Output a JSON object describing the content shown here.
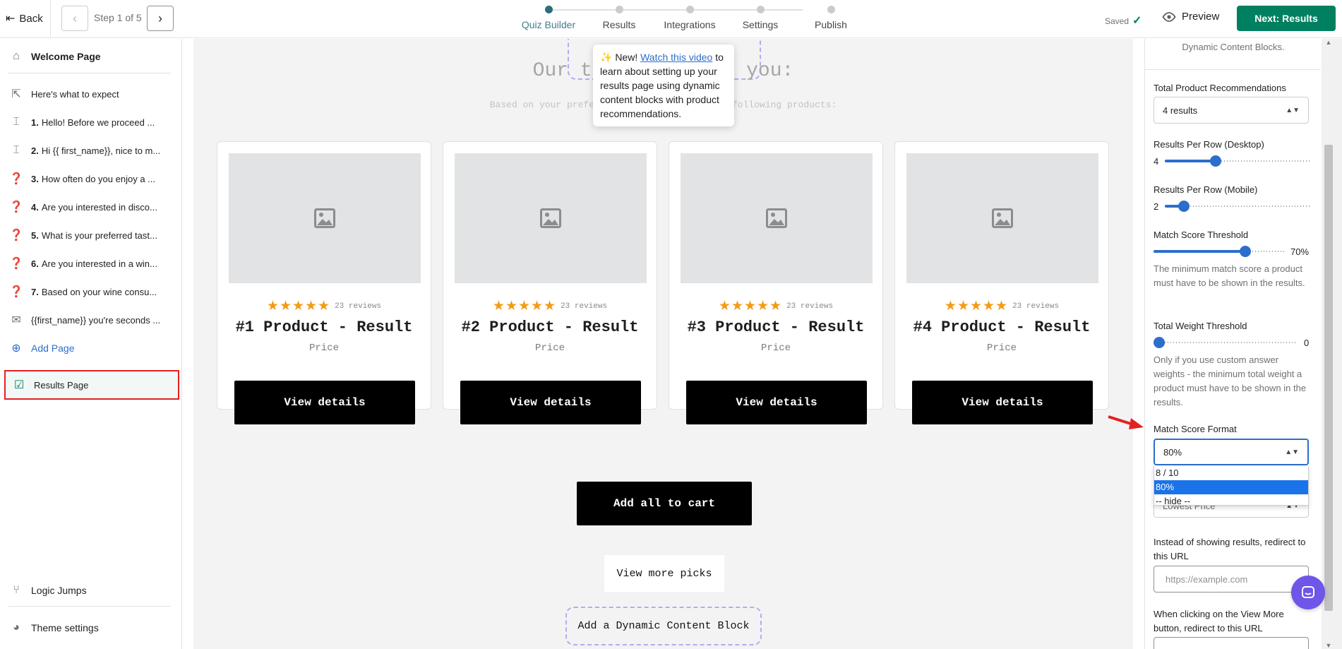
{
  "topbar": {
    "back_label": "Back",
    "step_label": "Step 1 of 5",
    "steps": [
      "Quiz Builder",
      "Results",
      "Integrations",
      "Settings",
      "Publish"
    ],
    "saved_label": "Saved",
    "preview_label": "Preview",
    "next_label": "Next: Results"
  },
  "sidebar": {
    "welcome": "Welcome Page",
    "expect": "Here's what to expect",
    "questions": [
      {
        "num": "1.",
        "text": "Hello! Before we proceed ..."
      },
      {
        "num": "2.",
        "text": "Hi {{ first_name}}, nice to m..."
      },
      {
        "num": "3.",
        "text": "How often do you enjoy a ..."
      },
      {
        "num": "4.",
        "text": "Are you interested in disco..."
      },
      {
        "num": "5.",
        "text": "What is your preferred tast..."
      },
      {
        "num": "6.",
        "text": "Are you interested in a win..."
      },
      {
        "num": "7.",
        "text": "Based on your wine consu..."
      }
    ],
    "first_name_page": "{{first_name}} you're seconds ...",
    "add_page": "Add Page",
    "results_page": "Results Page",
    "logic_jumps": "Logic Jumps",
    "theme_settings": "Theme settings"
  },
  "canvas": {
    "title": "Our top picks for you:",
    "subtitle": "Based on your preferences, we recommend the following products:",
    "tooltip": {
      "prefix": "✨ New! ",
      "link": "Watch this video",
      "suffix": " to learn about setting up your results page using dynamic content blocks with product recommendations."
    },
    "products": [
      {
        "name": "#1 Product - Result",
        "reviews": "23 reviews",
        "price": "Price",
        "button": "View details",
        "rating": 5
      },
      {
        "name": "#2 Product - Result",
        "reviews": "23 reviews",
        "price": "Price",
        "button": "View details",
        "rating": 5
      },
      {
        "name": "#3 Product - Result",
        "reviews": "23 reviews",
        "price": "Price",
        "button": "View details",
        "rating": 5
      },
      {
        "name": "#4 Product - Result",
        "reviews": "23 reviews",
        "price": "Price",
        "button": "View details",
        "rating": 5
      }
    ],
    "add_all": "Add all to cart",
    "more_picks": "View more picks",
    "dynamic_block": "Add a Dynamic Content Block"
  },
  "panel": {
    "top_note": "Dynamic Content Blocks.",
    "total_recs_label": "Total Product Recommendations",
    "total_recs_value": "4 results",
    "per_row_desktop_label": "Results Per Row (Desktop)",
    "per_row_desktop_value": "4",
    "per_row_desktop_fraction": 0.35,
    "per_row_mobile_label": "Results Per Row (Mobile)",
    "per_row_mobile_value": "2",
    "per_row_mobile_fraction": 0.13,
    "match_threshold_label": "Match Score Threshold",
    "match_threshold_value": "70%",
    "match_threshold_fraction": 0.7,
    "match_threshold_help": "The minimum match score a product must have to be shown in the results.",
    "weight_threshold_label": "Total Weight Threshold",
    "weight_threshold_value": "0",
    "weight_threshold_fraction": 0,
    "weight_threshold_help": "Only if you use custom answer weights - the minimum total weight a product must have to be shown in the results.",
    "match_format_label": "Match Score Format",
    "match_format_value": "80%",
    "match_format_options": [
      "8 / 10",
      "80%",
      "-- hide --"
    ],
    "sort_value": "Lowest Price",
    "redirect_label": "Instead of showing results, redirect to this URL",
    "redirect_placeholder": "https://example.com",
    "view_more_label": "When clicking on the View More button, redirect to this URL"
  },
  "colors": {
    "primary_green": "#008060",
    "slider_blue": "#2c6ecb",
    "star_orange": "#f49b13",
    "highlight_red": "#e32121",
    "chat_purple": "#6f55e8"
  }
}
